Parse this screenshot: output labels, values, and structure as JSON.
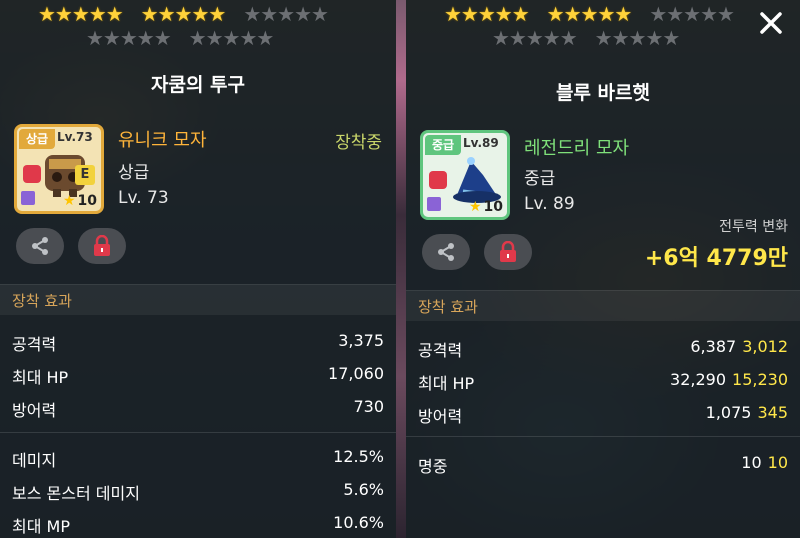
{
  "left": {
    "stars_row1_on": "★★★★★",
    "stars_row1b_on": "★★★★★",
    "stars_row1_off": "★★★★★",
    "stars_row2a_off": "★★★★★",
    "stars_row2b_off": "★★★★★",
    "title": "자쿰의 투구",
    "grade_tag": "상급",
    "level_tag": "Lv.73",
    "item_name": "유니크 모자",
    "grade": "상급",
    "level": "Lv. 73",
    "equipped": "장착중",
    "star_count": "10",
    "section": "장착 효과",
    "stats": [
      {
        "label": "공격력",
        "value": "3,375"
      },
      {
        "label": "최대 HP",
        "value": "17,060"
      },
      {
        "label": "방어력",
        "value": "730"
      },
      {
        "label": "데미지",
        "value": "12.5%"
      },
      {
        "label": "보스 몬스터 데미지",
        "value": "5.6%"
      },
      {
        "label": "최대 MP",
        "value": "10.6%"
      }
    ]
  },
  "right": {
    "stars_row1_on": "★★★★★",
    "stars_row1b_on": "★★★★★",
    "stars_row1_off": "★★★★★",
    "stars_row2a_off": "★★★★★",
    "stars_row2b_off": "★★★★★",
    "title": "블루 바르햇",
    "grade_tag": "중급",
    "level_tag": "Lv.89",
    "item_name": "레전드리 모자",
    "grade": "중급",
    "level": "Lv. 89",
    "star_count": "10",
    "power_label": "전투력 변화",
    "power_value": "+6억 4779만",
    "section": "장착 효과",
    "stats": [
      {
        "label": "공격력",
        "value": "6,387",
        "bonus": "3,012"
      },
      {
        "label": "최대 HP",
        "value": "32,290",
        "bonus": "15,230"
      },
      {
        "label": "방어력",
        "value": "1,075",
        "bonus": "345"
      },
      {
        "label": "명중",
        "value": "10",
        "bonus": "10"
      }
    ]
  },
  "colors": {
    "unique_name": "#ffb43a",
    "legendary_name": "#7fe07a",
    "unique_frame": "#e2a93b",
    "legendary_frame": "#5fc57e",
    "bonus": "#ffe74a",
    "section": "#d7a55a"
  },
  "icons": {
    "share": "share-icon",
    "lock": "lock-icon",
    "close": "close-icon"
  }
}
